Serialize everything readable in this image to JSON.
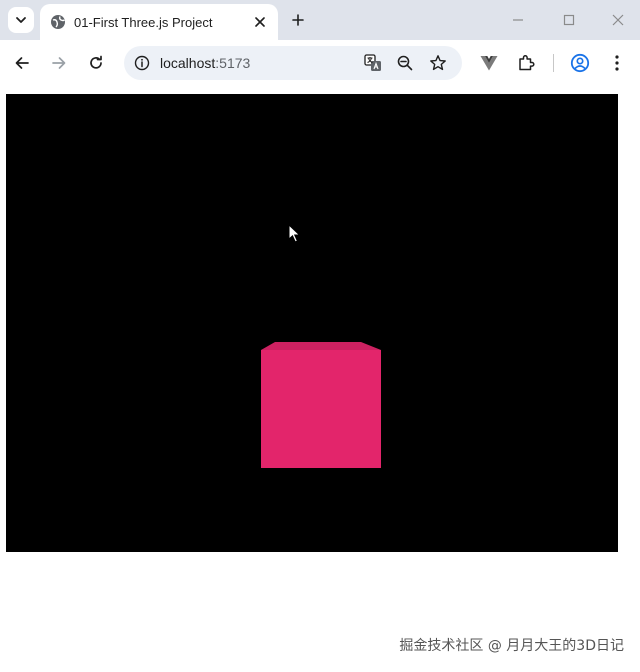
{
  "browser": {
    "tab": {
      "title": "01-First Three.js Project"
    },
    "address_bar": {
      "host": "localhost",
      "port": ":5173"
    }
  },
  "scene": {
    "background": "#000000",
    "cube_color": "#e3256b"
  },
  "watermark": "掘金技术社区 @ 月月大王的3D日记",
  "icons": [
    "chevron-down-icon",
    "globe-icon",
    "close-icon",
    "plus-icon",
    "minimize-icon",
    "maximize-icon",
    "close-window-icon",
    "back-arrow-icon",
    "forward-arrow-icon",
    "reload-icon",
    "info-icon",
    "translate-icon",
    "zoom-icon",
    "star-icon",
    "vue-devtools-icon",
    "extensions-icon",
    "profile-icon",
    "kebab-menu-icon",
    "mouse-cursor-icon"
  ]
}
